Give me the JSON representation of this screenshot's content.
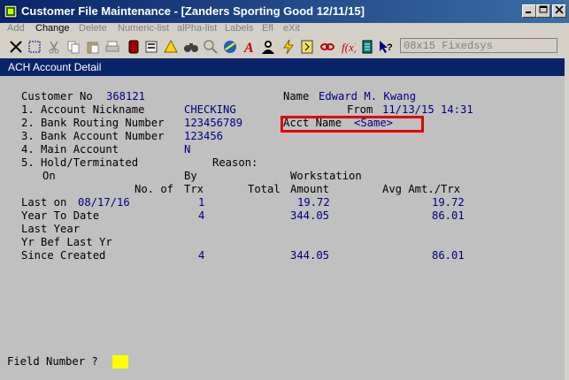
{
  "window": {
    "title": "Customer File Maintenance - [Zanders Sporting Good 12/11/15]"
  },
  "menu": {
    "add": "Add",
    "change": "Change",
    "delete": "Delete",
    "numeric_list": "Numeric-list",
    "alpha_list": "alPha-list",
    "labels": "Labels",
    "efl": "Efl",
    "exit": "eXit"
  },
  "toolbar": {
    "font_select": "08x15 Fixedsys"
  },
  "panel": {
    "title": "ACH Account Detail"
  },
  "form": {
    "customer_no_label": "Customer No",
    "customer_no": "368121",
    "name_label": "Name",
    "name": "Edward M. Kwang",
    "field1_label": "1. Account Nickname",
    "field1": "CHECKING",
    "from_label": "From",
    "from_value": "11/13/15 14:31",
    "field2_label": "2. Bank Routing Number",
    "field2": "123456789",
    "acct_name_label": "Acct Name",
    "acct_name": "<Same>",
    "field3_label": "3. Bank Account Number",
    "field3": "123456",
    "field4_label": "4. Main Account",
    "field4": "N",
    "field5_label": "5. Hold/Terminated",
    "reason_label": "Reason:",
    "prompt": "Field Number ?"
  },
  "stats": {
    "header1": {
      "on": "On",
      "by": "By",
      "workstation": "Workstation"
    },
    "header2": {
      "no_of": "No. of",
      "trx": "Trx",
      "total": "Total",
      "amount": "Amount",
      "avg": "Avg Amt./Trx"
    },
    "rows": [
      {
        "label": "Last on",
        "date": "08/17/16",
        "trx": "1",
        "amount": "19.72",
        "avg": "19.72"
      },
      {
        "label": "Year To Date",
        "date": "",
        "trx": "4",
        "amount": "344.05",
        "avg": "86.01"
      },
      {
        "label": "Last Year",
        "date": "",
        "trx": "",
        "amount": "",
        "avg": ""
      },
      {
        "label": "Yr Bef Last Yr",
        "date": "",
        "trx": "",
        "amount": "",
        "avg": ""
      },
      {
        "label": "Since Created",
        "date": "",
        "trx": "4",
        "amount": "344.05",
        "avg": "86.01"
      }
    ]
  }
}
